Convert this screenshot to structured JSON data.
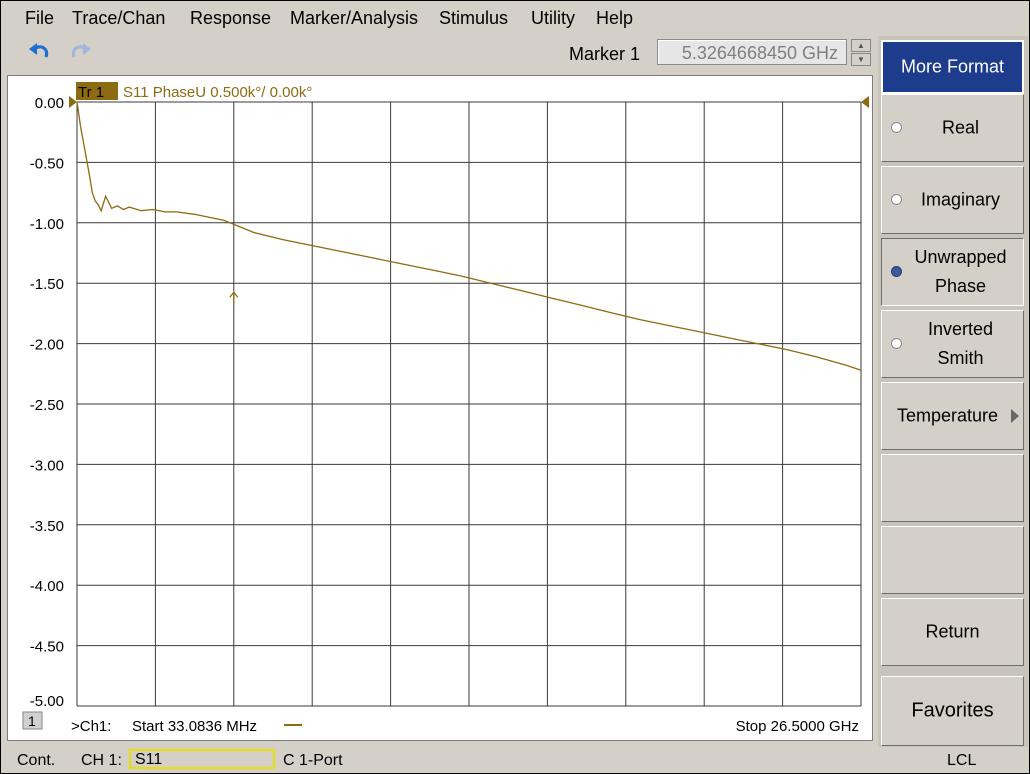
{
  "menu": [
    "File",
    "Trace/Chan",
    "Response",
    "Marker/Analysis",
    "Stimulus",
    "Utility",
    "Help"
  ],
  "toolbar": {
    "undo_icon": "undo-arrow-icon",
    "redo_icon": "redo-arrow-icon",
    "marker_label": "Marker 1",
    "marker_value": "5.3264668450 GHz"
  },
  "trace": {
    "tag": "Tr  1",
    "info": "S11 PhaseU 0.500k°/  0.00k°",
    "color": "#8c6b12"
  },
  "chart_data": {
    "type": "line",
    "title": "S11 PhaseU 0.500k°/  0.00k°",
    "xlabel": "",
    "ylabel": "",
    "x_start_ghz": 0.0330836,
    "x_stop_ghz": 26.5,
    "ylim": [
      -5.0,
      0.0
    ],
    "yticks": [
      "0.00",
      "-0.50",
      "-1.00",
      "-1.50",
      "-2.00",
      "-2.50",
      "-3.00",
      "-3.50",
      "-4.00",
      "-4.50",
      "-5.00"
    ],
    "grid": true,
    "x_divisions": 10,
    "y_divisions": 10,
    "series": [
      {
        "x": [
          0.033,
          0.15,
          0.3,
          0.45,
          0.55,
          0.65,
          0.75,
          0.85,
          1.0,
          1.2,
          1.4,
          1.6,
          1.8,
          2.2,
          2.6,
          3.0,
          3.4,
          4.0,
          5.0,
          6.0,
          7.0,
          8.0,
          9.0,
          10.0,
          11.0,
          12.0,
          13.0,
          14.0,
          15.0,
          16.0,
          17.0,
          18.0,
          19.0,
          20.0,
          21.0,
          22.0,
          23.0,
          24.0,
          25.0,
          26.0,
          26.5
        ],
        "y": [
          0.0,
          -0.2,
          -0.4,
          -0.6,
          -0.75,
          -0.82,
          -0.85,
          -0.9,
          -0.78,
          -0.88,
          -0.86,
          -0.89,
          -0.87,
          -0.9,
          -0.89,
          -0.91,
          -0.91,
          -0.93,
          -0.98,
          -1.08,
          -1.14,
          -1.19,
          -1.24,
          -1.29,
          -1.34,
          -1.39,
          -1.44,
          -1.5,
          -1.56,
          -1.62,
          -1.68,
          -1.74,
          -1.8,
          -1.85,
          -1.9,
          -1.95,
          -2.0,
          -2.05,
          -2.11,
          -2.18,
          -2.22
        ]
      }
    ],
    "marker": {
      "label": "Marker 1",
      "x_ghz": 5.326466845,
      "y": -1.6
    }
  },
  "chart_footer": {
    "channel_num": "1",
    "ch_label": ">Ch1:",
    "start": "Start  33.0836 MHz",
    "stop": "Stop  26.5000 GHz"
  },
  "softkeys": {
    "title": "More Format",
    "items": [
      {
        "label": "Real",
        "radio": true,
        "selected": false
      },
      {
        "label": "Imaginary",
        "radio": true,
        "selected": false
      },
      {
        "label": "Unwrapped Phase",
        "radio": true,
        "selected": true
      },
      {
        "label": "Inverted Smith",
        "radio": true,
        "selected": false
      },
      {
        "label": "Temperature",
        "radio": false,
        "submenu": true
      },
      {
        "label": "",
        "radio": false
      },
      {
        "label": "",
        "radio": false
      },
      {
        "label": "Return",
        "radio": false
      },
      {
        "label": "Favorites",
        "radio": false
      }
    ]
  },
  "status": {
    "mode": "Cont.",
    "channel": "CH 1:",
    "trace": "S11",
    "cal": "C  1-Port",
    "remote": "LCL"
  }
}
